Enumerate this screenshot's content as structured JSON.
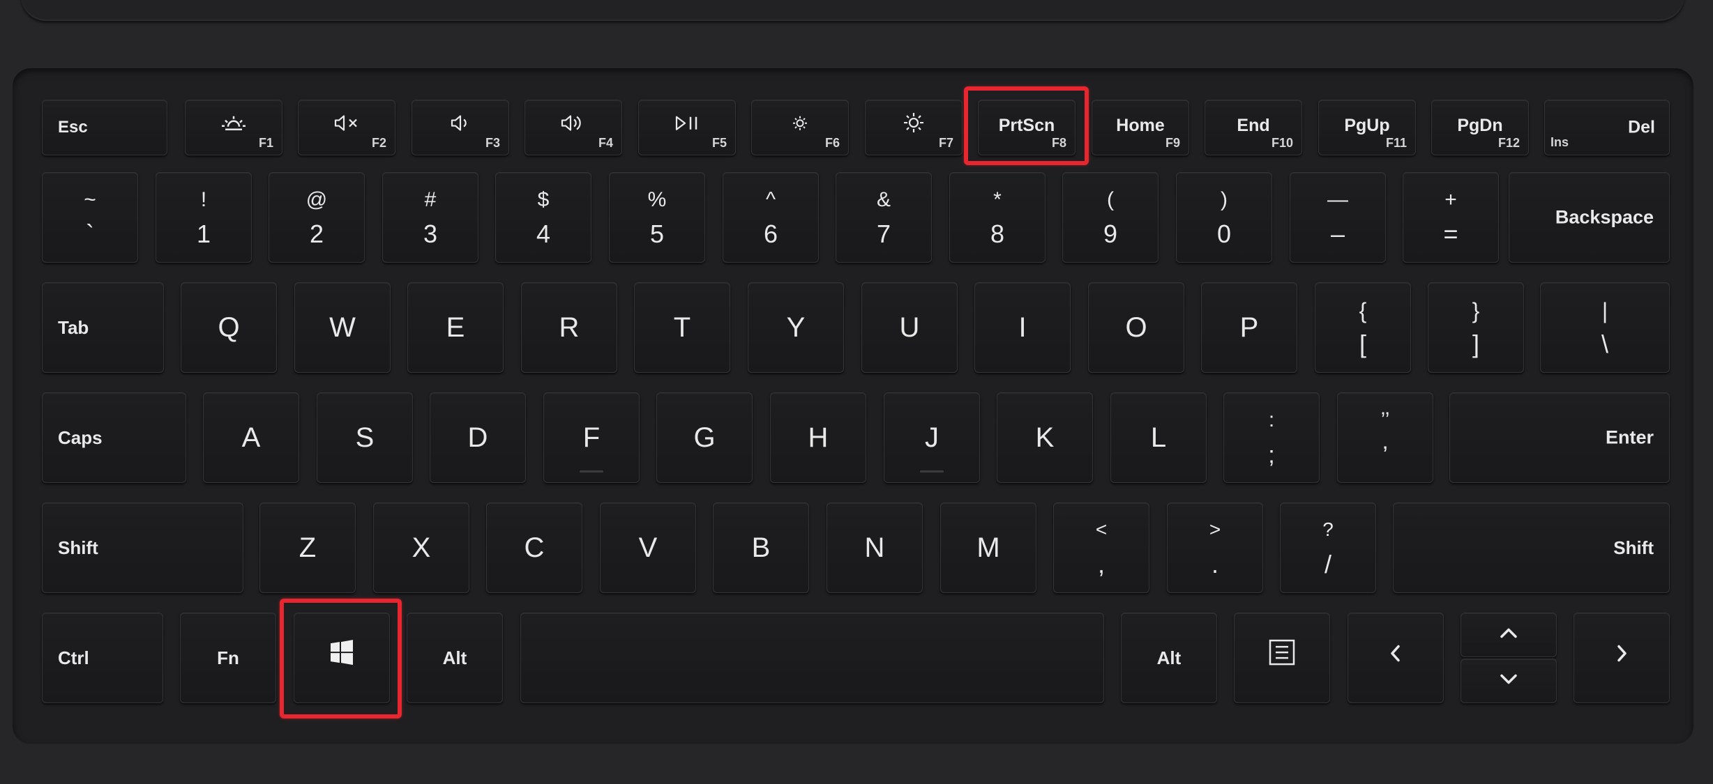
{
  "colors": {
    "background": "#262628",
    "key": "#1c1c1e",
    "legend": "#e9e9ea",
    "highlight": "#e8262f"
  },
  "function_row": [
    {
      "label": "Esc",
      "fn": ""
    },
    {
      "icon": "brightness-sunrise-icon",
      "fn": "F1"
    },
    {
      "icon": "mute-icon",
      "fn": "F2"
    },
    {
      "icon": "volume-down-icon",
      "fn": "F3"
    },
    {
      "icon": "volume-up-icon",
      "fn": "F4"
    },
    {
      "icon": "play-pause-icon",
      "fn": "F5"
    },
    {
      "icon": "brightness-down-icon",
      "fn": "F6"
    },
    {
      "icon": "brightness-up-icon",
      "fn": "F7"
    },
    {
      "label": "PrtScn",
      "fn": "F8"
    },
    {
      "label": "Home",
      "fn": "F9"
    },
    {
      "label": "End",
      "fn": "F10"
    },
    {
      "label": "PgUp",
      "fn": "F11"
    },
    {
      "label": "PgDn",
      "fn": "F12"
    },
    {
      "label": "Del",
      "sub": "Ins"
    }
  ],
  "number_row": [
    {
      "top": "~",
      "bottom": "`"
    },
    {
      "top": "!",
      "bottom": "1"
    },
    {
      "top": "@",
      "bottom": "2"
    },
    {
      "top": "#",
      "bottom": "3"
    },
    {
      "top": "$",
      "bottom": "4"
    },
    {
      "top": "%",
      "bottom": "5"
    },
    {
      "top": "^",
      "bottom": "6"
    },
    {
      "top": "&",
      "bottom": "7"
    },
    {
      "top": "*",
      "bottom": "8"
    },
    {
      "top": "(",
      "bottom": "9"
    },
    {
      "top": ")",
      "bottom": "0"
    },
    {
      "top": "—",
      "bottom": "–"
    },
    {
      "top": "+",
      "bottom": "="
    },
    {
      "label": "Backspace"
    }
  ],
  "qwerty_row": {
    "tab": "Tab",
    "letters": [
      "Q",
      "W",
      "E",
      "R",
      "T",
      "Y",
      "U",
      "I",
      "O",
      "P"
    ],
    "brackets": [
      {
        "top": "{",
        "bottom": "["
      },
      {
        "top": "}",
        "bottom": "]"
      },
      {
        "top": "|",
        "bottom": "\\"
      }
    ]
  },
  "home_row": {
    "caps": "Caps",
    "letters": [
      "A",
      "S",
      "D",
      "F",
      "G",
      "H",
      "J",
      "K",
      "L"
    ],
    "punct": [
      {
        "top": ":",
        "bottom": ";"
      },
      {
        "top": "’’",
        "bottom": "’"
      }
    ],
    "enter": "Enter"
  },
  "bottom_letter_row": {
    "shift_left": "Shift",
    "letters": [
      "Z",
      "X",
      "C",
      "V",
      "B",
      "N",
      "M"
    ],
    "punct": [
      {
        "top": "<",
        "bottom": ","
      },
      {
        "top": ">",
        "bottom": "."
      },
      {
        "top": "?",
        "bottom": "/"
      }
    ],
    "shift_right": "Shift"
  },
  "modifier_row": {
    "ctrl": "Ctrl",
    "fn": "Fn",
    "win_icon": "windows-logo-icon",
    "alt_left": "Alt",
    "alt_right": "Alt",
    "menu_icon": "context-menu-icon",
    "arrows": [
      "arrow-left-icon",
      "arrow-up-icon",
      "arrow-down-icon",
      "arrow-right-icon"
    ]
  },
  "highlighted_keys": [
    "PrtScn",
    "windows-logo-icon"
  ]
}
